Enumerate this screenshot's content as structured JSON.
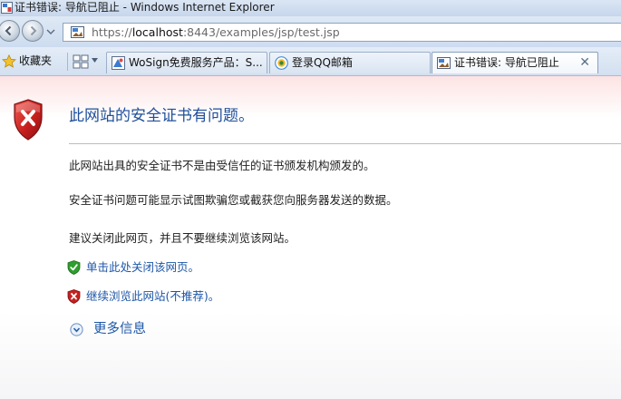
{
  "window": {
    "title": "证书错误: 导航已阻止 - Windows Internet Explorer"
  },
  "address_bar": {
    "url_prefix": "https://",
    "url_host": "localhost",
    "url_rest": ":8443/examples/jsp/test.jsp"
  },
  "favorites": {
    "label": "收藏夹"
  },
  "tabs": [
    {
      "label": "WoSign免费服务产品：S...",
      "icon": "wosign-icon",
      "active": false
    },
    {
      "label": "登录QQ邮箱",
      "icon": "qq-mail-icon",
      "active": false
    },
    {
      "label": "证书错误: 导航已阻止",
      "icon": "page-icon",
      "active": true,
      "close": "✕"
    }
  ],
  "content": {
    "title": "此网站的安全证书有问题。",
    "paragraphs": [
      "此网站出具的安全证书不是由受信任的证书颁发机构颁发的。",
      "安全证书问题可能显示试图欺骗您或截获您向服务器发送的数据。",
      "建议关闭此网页，并且不要继续浏览该网站。"
    ],
    "links": [
      {
        "label": "单击此处关闭该网页。",
        "icon": "green-shield-check-icon"
      },
      {
        "label": "继续浏览此网站(不推荐)。",
        "icon": "red-shield-x-icon"
      }
    ],
    "more_info": "更多信息"
  },
  "colors": {
    "title_blue": "#1f4f9a",
    "link_blue": "#1c56a8",
    "shield_red": "#c8201f",
    "shield_green": "#2e9e2e"
  }
}
